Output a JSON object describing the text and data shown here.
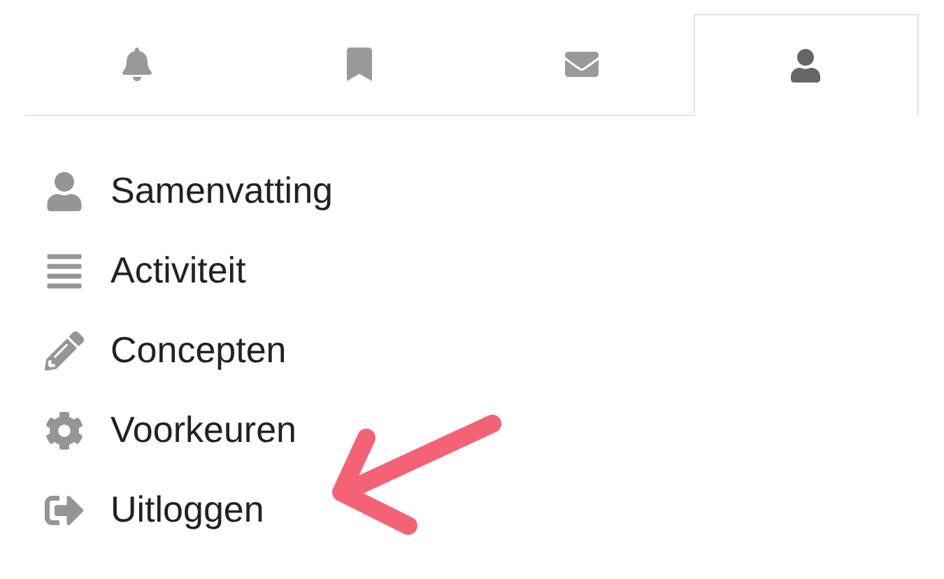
{
  "tabs": [
    {
      "kind": "bell",
      "selected": false
    },
    {
      "kind": "bookmark",
      "selected": false
    },
    {
      "kind": "envelope",
      "selected": false
    },
    {
      "kind": "user",
      "selected": true
    }
  ],
  "menu": [
    {
      "kind": "user",
      "label": "Samenvatting"
    },
    {
      "kind": "bars",
      "label": "Activiteit"
    },
    {
      "kind": "pencil",
      "label": "Concepten"
    },
    {
      "kind": "gear",
      "label": "Voorkeuren"
    },
    {
      "kind": "signout",
      "label": "Uitloggen"
    }
  ]
}
